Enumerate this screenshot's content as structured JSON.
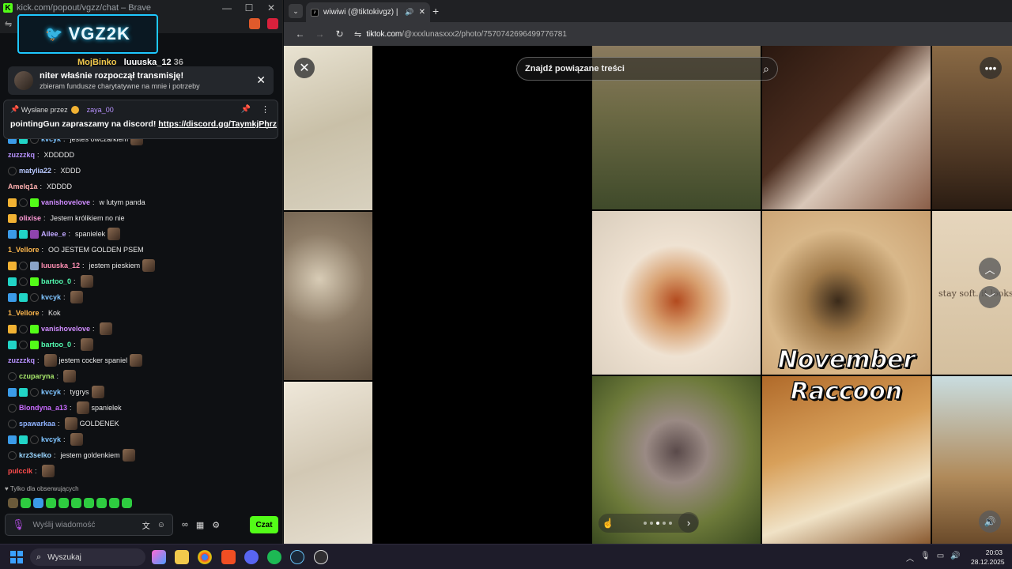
{
  "left_window": {
    "title": "kick.com/popout/vgzz/chat – Brave",
    "logo_text": "VGZ2K",
    "pinned_users_text": "MojBinko",
    "pinned_users_text2": "luuuska_12",
    "pinned_users_count": "36",
    "banner": {
      "title": "niter właśnie rozpoczął transmisję!",
      "subtitle": "zbieram fundusze charytatywne na mnie i potrzeby",
      "close": "✕"
    },
    "pinned_message": {
      "sent_by": "Wysłane przez",
      "sender": "zaya_00",
      "text": "pointingGun zapraszamy na discord!",
      "link": "https://discord.gg/TaymkjPhrz"
    },
    "messages": [
      {
        "user": "kvcyk",
        "text": "jestes owczarkiem",
        "color": "#7fc4ff"
      },
      {
        "user": "zuzzzkq",
        "text": "XDDDDD",
        "color": "#b892ff"
      },
      {
        "user": "matylia22",
        "text": "XDDD",
        "color": "#b8c8ff"
      },
      {
        "user": "Amelq1a",
        "text": "XDDDD",
        "color": "#ffb0b0"
      },
      {
        "user": "vanishovelove",
        "text": "w lutym panda",
        "color": "#d08cff"
      },
      {
        "user": "olixise",
        "text": "Jestem królikiem no nie",
        "color": "#ff9ad6"
      },
      {
        "user": "Ailee_e",
        "text": "spanielek",
        "color": "#c0a8ff"
      },
      {
        "user": "1_Vellore",
        "text": "OO JESTEM GOLDEN PSEM",
        "color": "#ffb84d"
      },
      {
        "user": "luuuska_12",
        "text": "jestem pieskiem",
        "color": "#ff8fb3"
      },
      {
        "user": "bartoo_0",
        "text": "",
        "color": "#53fcb0"
      },
      {
        "user": "kvcyk",
        "text": "",
        "color": "#7fc4ff"
      },
      {
        "user": "1_Vellore",
        "text": "Kok",
        "color": "#ffb84d"
      },
      {
        "user": "vanishovelove",
        "text": "",
        "color": "#d08cff"
      },
      {
        "user": "bartoo_0",
        "text": "",
        "color": "#53fcb0"
      },
      {
        "user": "zuzzzkq",
        "text": "jestem cocker spaniel",
        "color": "#b892ff"
      },
      {
        "user": "czuparyna",
        "text": "",
        "color": "#a8e86b"
      },
      {
        "user": "kvcyk",
        "text": "tygrys",
        "color": "#7fc4ff"
      },
      {
        "user": "Blondyna_a13",
        "text": "spanielek",
        "color": "#c96bff"
      },
      {
        "user": "spawarkaa",
        "text": "GOLDENEK",
        "color": "#8fb3ff"
      },
      {
        "user": "kvcyk",
        "text": "",
        "color": "#7fc4ff"
      },
      {
        "user": "krz3selko",
        "text": "jestem goldenkiem",
        "color": "#9ad6ff"
      },
      {
        "user": "pulccik",
        "text": "",
        "color": "#ff4d4d"
      }
    ],
    "followers_only": "Tylko dla obserwujących",
    "input_placeholder": "Wyślij wiadomość",
    "send_label": "Czat"
  },
  "browser": {
    "tab_title": "wiwiwi (@tiktokivgz) | TikTok",
    "url_host": "tiktok.com",
    "url_path": "/@xxxlunasxxx2/photo/7570742696499776781",
    "search_placeholder": "Znajdź powiązane treści",
    "note_text": "stay soft. it looks",
    "caption_line1": "November",
    "caption_line2": "Raccoon"
  },
  "taskbar": {
    "search_label": "Wyszukaj",
    "time": "20:03",
    "date": "28.12.2025"
  }
}
